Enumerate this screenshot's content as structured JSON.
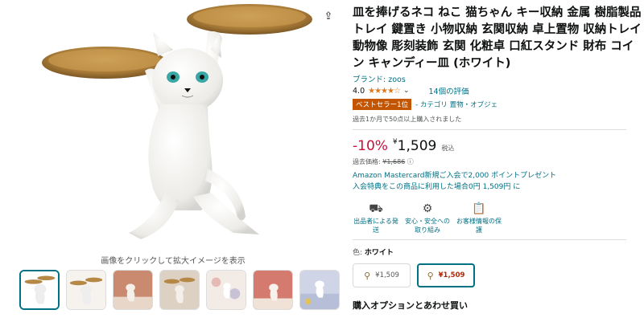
{
  "gallery": {
    "caption": "画像をクリックして拡大イメージを表示",
    "thumbnail_count": 7
  },
  "product": {
    "title": "皿を捧げるネコ ねこ 猫ちゃん キー収納 金属 樹脂製品トレイ 鍵置き 小物収納 玄関収納 卓上置物 収納トレイ 動物像 彫刻装飾 玄関 化粧卓 口紅スタンド 財布 コイン キャンディー皿 (ホワイト)",
    "brand": "ブランド: zoos",
    "rating_value": "4.0",
    "stars": "★★★★☆",
    "rating": 4.0,
    "review_count": "14個の評価",
    "bestseller_badge": "ベストセラー1位",
    "category": "- カテゴリ 置物・オブジェ",
    "sold_text": "過去1か月で50点以上購入されました"
  },
  "pricing": {
    "discount": "-10%",
    "yen_symbol": "¥",
    "price": "1,509",
    "tax_label": "税込",
    "list_price_label": "過去価格: ",
    "list_price": "¥1,686",
    "info_icon": "ⓘ",
    "points_line1": "Amazon Mastercard新規ご入会で2,000 ポイントプレゼント",
    "points_line2": "入会特典をこの商品に利用した場合0円 1,509円 に"
  },
  "features": [
    {
      "icon": "truck-icon",
      "glyph": "⛟",
      "label": "出品者による発送"
    },
    {
      "icon": "shield-icon",
      "glyph": "⚙",
      "label": "安心・安全への取り組み"
    },
    {
      "icon": "clipboard-icon",
      "glyph": "📋",
      "label": "お客様情報の保護"
    }
  ],
  "variant_section": {
    "color_label": "色: ",
    "color_value": "ホワイト",
    "variants": [
      {
        "price": "¥1,509"
      },
      {
        "price": "¥1,509"
      }
    ],
    "options_title": "購入オプションとあわせ買い"
  },
  "colors": {
    "accent": "#007185",
    "discount": "#cc0c39",
    "badge": "#c45500",
    "star": "#de7921"
  }
}
